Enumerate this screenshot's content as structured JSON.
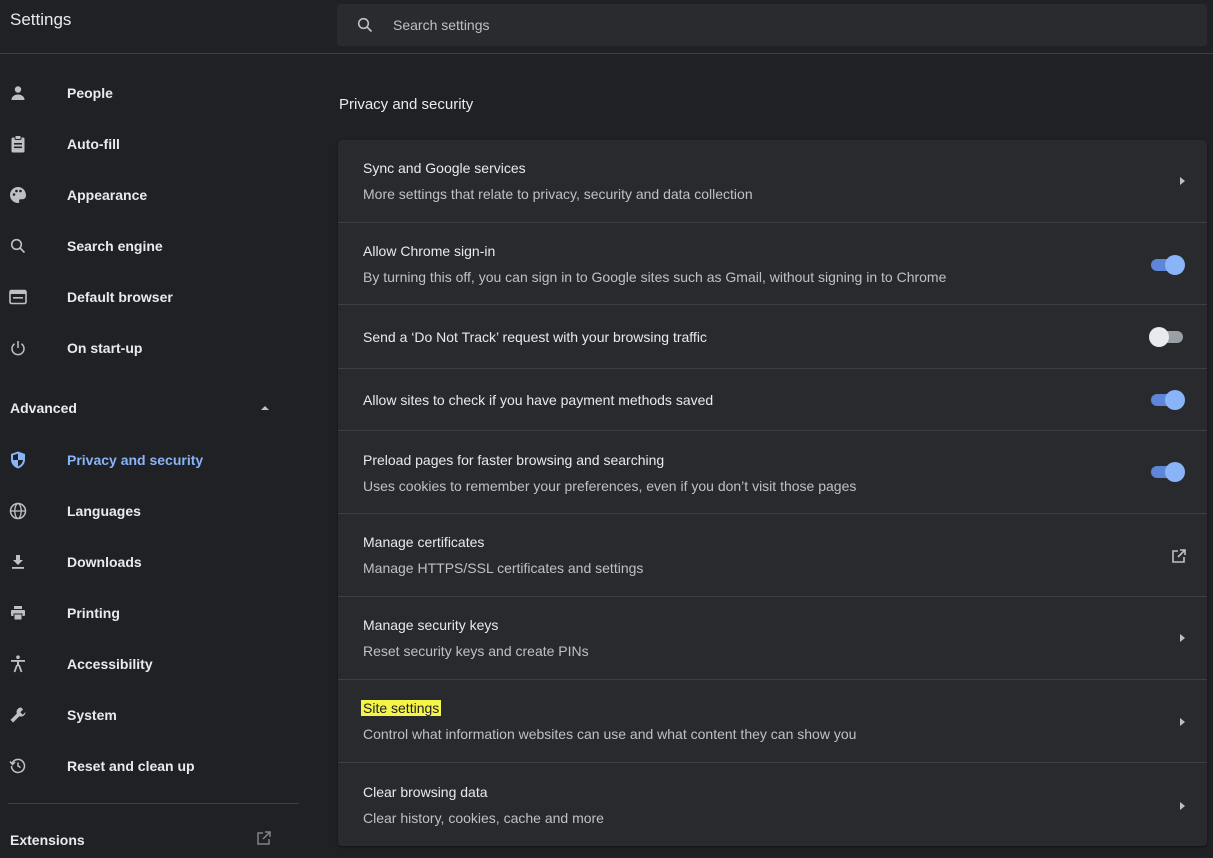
{
  "header": {
    "title": "Settings",
    "search_placeholder": "Search settings"
  },
  "sidebar": {
    "items": [
      {
        "label": "People",
        "icon": "person-icon"
      },
      {
        "label": "Auto-fill",
        "icon": "clipboard-icon"
      },
      {
        "label": "Appearance",
        "icon": "palette-icon"
      },
      {
        "label": "Search engine",
        "icon": "search-icon"
      },
      {
        "label": "Default browser",
        "icon": "browser-icon"
      },
      {
        "label": "On start-up",
        "icon": "power-icon"
      }
    ],
    "advanced_label": "Advanced",
    "advanced_items": [
      {
        "label": "Privacy and security",
        "icon": "shield-icon",
        "active": true
      },
      {
        "label": "Languages",
        "icon": "globe-icon"
      },
      {
        "label": "Downloads",
        "icon": "download-icon"
      },
      {
        "label": "Printing",
        "icon": "printer-icon"
      },
      {
        "label": "Accessibility",
        "icon": "accessibility-icon"
      },
      {
        "label": "System",
        "icon": "wrench-icon"
      },
      {
        "label": "Reset and clean up",
        "icon": "restore-icon"
      }
    ],
    "extensions_label": "Extensions"
  },
  "main": {
    "section_title": "Privacy and security",
    "rows": [
      {
        "title": "Sync and Google services",
        "subtitle": "More settings that relate to privacy, security and data collection",
        "action": "arrow"
      },
      {
        "title": "Allow Chrome sign-in",
        "subtitle": "By turning this off, you can sign in to Google sites such as Gmail, without signing in to Chrome",
        "action": "toggle-on"
      },
      {
        "title": "Send a ‘Do Not Track’ request with your browsing traffic",
        "subtitle": "",
        "action": "toggle-off"
      },
      {
        "title": "Allow sites to check if you have payment methods saved",
        "subtitle": "",
        "action": "toggle-on"
      },
      {
        "title": "Preload pages for faster browsing and searching",
        "subtitle": "Uses cookies to remember your preferences, even if you don’t visit those pages",
        "action": "toggle-on"
      },
      {
        "title": "Manage certificates",
        "subtitle": "Manage HTTPS/SSL certificates and settings",
        "action": "external"
      },
      {
        "title": "Manage security keys",
        "subtitle": "Reset security keys and create PINs",
        "action": "arrow"
      },
      {
        "title": "Site settings",
        "subtitle": "Control what information websites can use and what content they can show you",
        "action": "arrow",
        "highlighted": true
      },
      {
        "title": "Clear browsing data",
        "subtitle": "Clear history, cookies, cache and more",
        "action": "arrow"
      }
    ]
  },
  "colors": {
    "background": "#202124",
    "card": "#292a2d",
    "accent": "#8ab4f8",
    "highlight": "#f5f549"
  }
}
